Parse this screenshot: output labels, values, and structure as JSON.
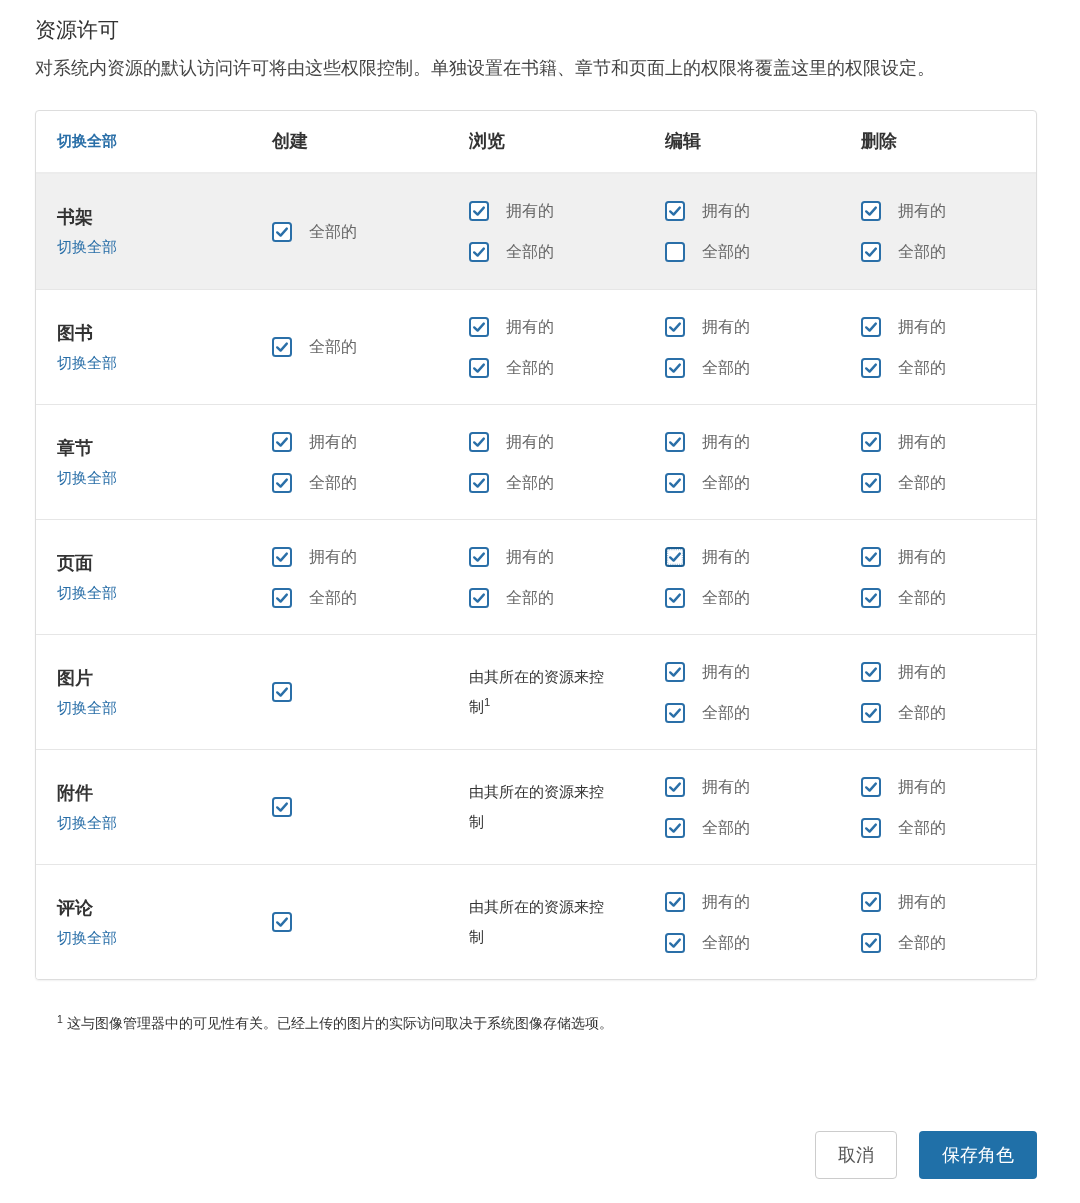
{
  "section": {
    "title": "资源许可",
    "description": "对系统内资源的默认访问许可将由这些权限控制。单独设置在书籍、章节和页面上的权限将覆盖这里的权限设定。"
  },
  "table": {
    "toggle_all": "切换全部",
    "columns": [
      "创建",
      "浏览",
      "编辑",
      "删除"
    ],
    "rows": [
      {
        "name": "书架",
        "toggle_all": "切换全部",
        "highlighted": true,
        "cells": [
          {
            "kind": "checks",
            "options": [
              {
                "label": "全部的",
                "checked": true,
                "focused": false
              }
            ]
          },
          {
            "kind": "checks",
            "options": [
              {
                "label": "拥有的",
                "checked": true,
                "focused": false
              },
              {
                "label": "全部的",
                "checked": true,
                "focused": false
              }
            ]
          },
          {
            "kind": "checks",
            "options": [
              {
                "label": "拥有的",
                "checked": true,
                "focused": false
              },
              {
                "label": "全部的",
                "checked": false,
                "focused": false
              }
            ]
          },
          {
            "kind": "checks",
            "options": [
              {
                "label": "拥有的",
                "checked": true,
                "focused": false
              },
              {
                "label": "全部的",
                "checked": true,
                "focused": false
              }
            ]
          }
        ]
      },
      {
        "name": "图书",
        "toggle_all": "切换全部",
        "highlighted": false,
        "cells": [
          {
            "kind": "checks",
            "options": [
              {
                "label": "全部的",
                "checked": true,
                "focused": false
              }
            ]
          },
          {
            "kind": "checks",
            "options": [
              {
                "label": "拥有的",
                "checked": true,
                "focused": false
              },
              {
                "label": "全部的",
                "checked": true,
                "focused": false
              }
            ]
          },
          {
            "kind": "checks",
            "options": [
              {
                "label": "拥有的",
                "checked": true,
                "focused": false
              },
              {
                "label": "全部的",
                "checked": true,
                "focused": false
              }
            ]
          },
          {
            "kind": "checks",
            "options": [
              {
                "label": "拥有的",
                "checked": true,
                "focused": false
              },
              {
                "label": "全部的",
                "checked": true,
                "focused": false
              }
            ]
          }
        ]
      },
      {
        "name": "章节",
        "toggle_all": "切换全部",
        "highlighted": false,
        "cells": [
          {
            "kind": "checks",
            "options": [
              {
                "label": "拥有的",
                "checked": true,
                "focused": false
              },
              {
                "label": "全部的",
                "checked": true,
                "focused": false
              }
            ]
          },
          {
            "kind": "checks",
            "options": [
              {
                "label": "拥有的",
                "checked": true,
                "focused": false
              },
              {
                "label": "全部的",
                "checked": true,
                "focused": false
              }
            ]
          },
          {
            "kind": "checks",
            "options": [
              {
                "label": "拥有的",
                "checked": true,
                "focused": false
              },
              {
                "label": "全部的",
                "checked": true,
                "focused": false
              }
            ]
          },
          {
            "kind": "checks",
            "options": [
              {
                "label": "拥有的",
                "checked": true,
                "focused": false
              },
              {
                "label": "全部的",
                "checked": true,
                "focused": false
              }
            ]
          }
        ]
      },
      {
        "name": "页面",
        "toggle_all": "切换全部",
        "highlighted": false,
        "cells": [
          {
            "kind": "checks",
            "options": [
              {
                "label": "拥有的",
                "checked": true,
                "focused": false
              },
              {
                "label": "全部的",
                "checked": true,
                "focused": false
              }
            ]
          },
          {
            "kind": "checks",
            "options": [
              {
                "label": "拥有的",
                "checked": true,
                "focused": false
              },
              {
                "label": "全部的",
                "checked": true,
                "focused": false
              }
            ]
          },
          {
            "kind": "checks",
            "options": [
              {
                "label": "拥有的",
                "checked": true,
                "focused": true
              },
              {
                "label": "全部的",
                "checked": true,
                "focused": false
              }
            ]
          },
          {
            "kind": "checks",
            "options": [
              {
                "label": "拥有的",
                "checked": true,
                "focused": false
              },
              {
                "label": "全部的",
                "checked": true,
                "focused": false
              }
            ]
          }
        ]
      },
      {
        "name": "图片",
        "toggle_all": "切换全部",
        "highlighted": false,
        "cells": [
          {
            "kind": "checks",
            "options": [
              {
                "checked": true,
                "focused": false
              }
            ]
          },
          {
            "kind": "note",
            "text": "由其所在的资源来控制$^{1}$"
          },
          {
            "kind": "checks",
            "options": [
              {
                "label": "拥有的",
                "checked": true,
                "focused": false
              },
              {
                "label": "全部的",
                "checked": true,
                "focused": false
              }
            ]
          },
          {
            "kind": "checks",
            "options": [
              {
                "label": "拥有的",
                "checked": true,
                "focused": false
              },
              {
                "label": "全部的",
                "checked": true,
                "focused": false
              }
            ]
          }
        ]
      },
      {
        "name": "附件",
        "toggle_all": "切换全部",
        "highlighted": false,
        "cells": [
          {
            "kind": "checks",
            "options": [
              {
                "checked": true,
                "focused": false
              }
            ]
          },
          {
            "kind": "note",
            "text": "由其所在的资源来控制"
          },
          {
            "kind": "checks",
            "options": [
              {
                "label": "拥有的",
                "checked": true,
                "focused": false
              },
              {
                "label": "全部的",
                "checked": true,
                "focused": false
              }
            ]
          },
          {
            "kind": "checks",
            "options": [
              {
                "label": "拥有的",
                "checked": true,
                "focused": false
              },
              {
                "label": "全部的",
                "checked": true,
                "focused": false
              }
            ]
          }
        ]
      },
      {
        "name": "评论",
        "toggle_all": "切换全部",
        "highlighted": false,
        "cells": [
          {
            "kind": "checks",
            "options": [
              {
                "checked": true,
                "focused": false
              }
            ]
          },
          {
            "kind": "note",
            "text": "由其所在的资源来控制"
          },
          {
            "kind": "checks",
            "options": [
              {
                "label": "拥有的",
                "checked": true,
                "focused": false
              },
              {
                "label": "全部的",
                "checked": true,
                "focused": false
              }
            ]
          },
          {
            "kind": "checks",
            "options": [
              {
                "label": "拥有的",
                "checked": true,
                "focused": false
              },
              {
                "label": "全部的",
                "checked": true,
                "focused": false
              }
            ]
          }
        ]
      }
    ]
  },
  "footnote": "$^{1}$ 这与图像管理器中的可见性有关。已经上传的图片的实际访问取决于系统图像存储选项。",
  "buttons": [
    {
      "label": "取消",
      "kind": "secondary"
    },
    {
      "label": "保存角色",
      "kind": "primary"
    }
  ]
}
